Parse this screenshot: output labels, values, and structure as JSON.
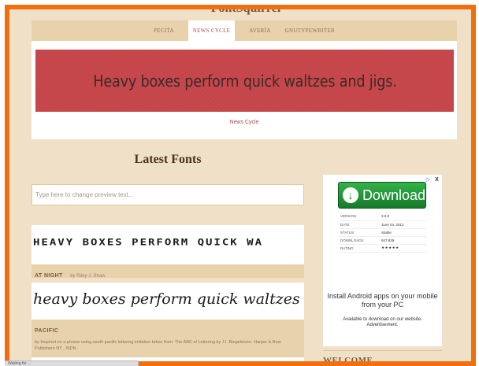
{
  "site": {
    "title": "FontSquirrel"
  },
  "featured": {
    "tabs": [
      {
        "label": "PECITA",
        "active": false
      },
      {
        "label": "NEWS CYCLE",
        "active": true
      },
      {
        "label": "AVERÍA",
        "active": false
      },
      {
        "label": "GNUTYPEWRITER",
        "active": false
      }
    ],
    "banner_text": "Heavy boxes perform quick waltzes and jigs.",
    "banner_caption": "News Cycle",
    "banner_color": "#c8484c"
  },
  "latest": {
    "heading": "Latest Fonts",
    "preview_placeholder": "Type here to change preview text...",
    "fonts": [
      {
        "preview": "HEAVY BOXES PERFORM QUICK WA",
        "name": "AT NIGHT",
        "by": "by Riley J. Shaw",
        "description": ""
      },
      {
        "preview": "heavy boxes perform quick waltzes and jig",
        "name": "PACIFIC",
        "by": "",
        "description": "by Inspired on a phrase using south pacific lettering imitation taken from: The ABC of Lettering by J.I. Biegeleisen. Harper & Row Publishers NY . ISDN -"
      }
    ]
  },
  "ad": {
    "button_label": "Download",
    "specs": [
      {
        "label": "VERSION",
        "value": "3.0.9"
      },
      {
        "label": "DATE",
        "value": "June 04, 2012"
      },
      {
        "label": "STATUS",
        "value": "Stable"
      },
      {
        "label": "DOWNLOADS",
        "value": "947,939"
      },
      {
        "label": "RATING",
        "value": "★★★★★"
      }
    ],
    "body": "Install Android apps on your mobile from your PC",
    "small_line1": "Available to download on our website.",
    "small_line2": "Advertisement.",
    "info_mark": "▷",
    "close_mark": "X"
  },
  "sidebar": {
    "welcome_heading": "WELCOME"
  },
  "status_bar": {
    "text": "Waiting for ..."
  },
  "colors": {
    "frame_border": "#f07010",
    "page_bg": "#f0e0c8",
    "tab_bar": "#e8d2ac",
    "accent_red": "#b44a4a"
  }
}
